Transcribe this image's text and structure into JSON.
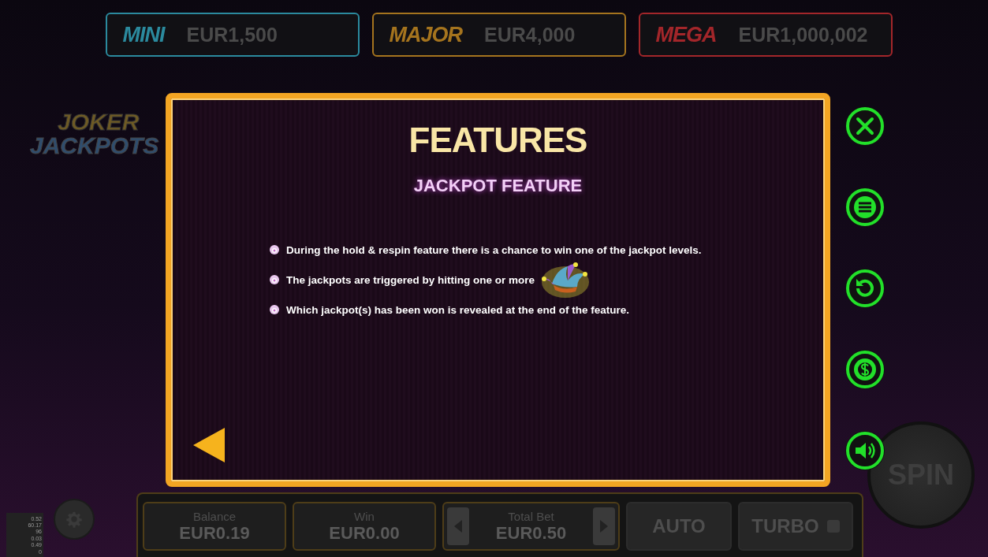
{
  "jackpots": [
    {
      "label": "MINI",
      "amount": "EUR1,500",
      "color": "#2b8a9e"
    },
    {
      "label": "MAJOR",
      "amount": "EUR4,000",
      "color": "#a5741e"
    },
    {
      "label": "MEGA",
      "amount": "EUR1,000,002",
      "color": "#a3262a"
    }
  ],
  "logo": {
    "line_1": "JOKER",
    "line_2": "JACKPOTS"
  },
  "dialog": {
    "title": "FEATURES",
    "subtitle": "JACKPOT FEATURE",
    "bullets": [
      {
        "text": "During the hold & respin feature there is a chance to win one of the jackpot levels.",
        "symbol": false
      },
      {
        "text": "The jackpots are triggered by hitting one or more",
        "symbol": true
      },
      {
        "text": "Which jackpot(s) has been won is revealed at the end of the feature.",
        "symbol": false
      }
    ]
  },
  "side_buttons": [
    {
      "kind": "close"
    },
    {
      "kind": "menu"
    },
    {
      "kind": "history"
    },
    {
      "kind": "bet"
    },
    {
      "kind": "sound"
    }
  ],
  "debug_stats": [
    "0.52",
    "60.17",
    "96",
    "0.03",
    "0.49",
    "0"
  ],
  "bottom_bar": {
    "balance": {
      "label": "Balance",
      "value": "EUR0.19"
    },
    "win": {
      "label": "Win",
      "value": "EUR0.00"
    },
    "total_bet": {
      "label": "Total Bet",
      "value": "EUR0.50"
    },
    "auto": "AUTO",
    "turbo": {
      "label": "TURBO",
      "on": false
    }
  },
  "spin": "SPIN"
}
